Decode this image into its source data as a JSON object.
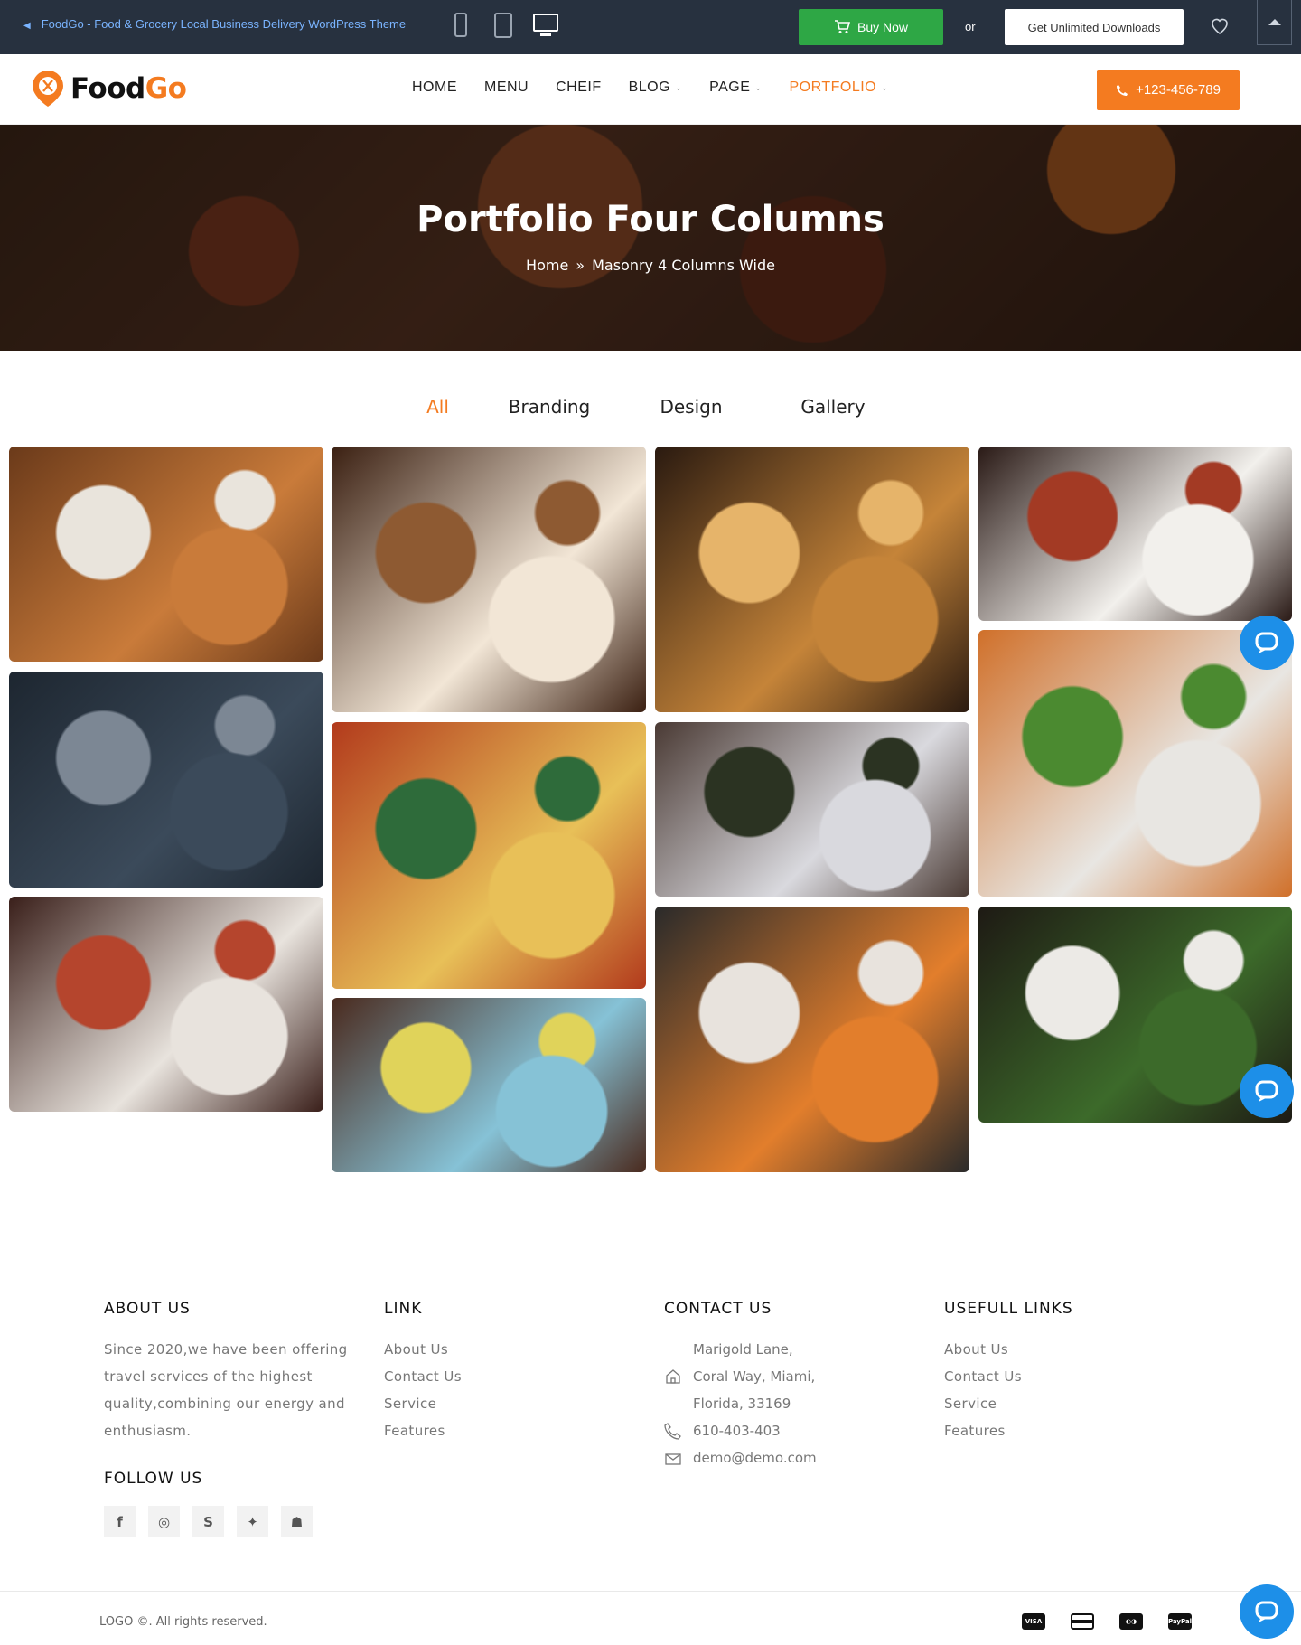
{
  "topbar": {
    "back_text": "FoodGo - Food & Grocery Local Business Delivery WordPress Theme",
    "buy_label": "Buy Now",
    "or_text": "or",
    "download_label": "Get Unlimited Downloads"
  },
  "header": {
    "logo_part1": "Food",
    "logo_part2": "Go",
    "nav": [
      {
        "label": "HOME"
      },
      {
        "label": "MENU"
      },
      {
        "label": "CHEIF"
      },
      {
        "label": "BLOG"
      },
      {
        "label": "PAGE"
      },
      {
        "label": "PORTFOLIO"
      }
    ],
    "phone": "+123-456-789"
  },
  "hero": {
    "title": "Portfolio Four Columns",
    "crumb_home": "Home",
    "crumb_sep": "»",
    "crumb_current": "Masonry 4 Columns Wide"
  },
  "filters": [
    "All",
    "Branding",
    "Design",
    "Gallery"
  ],
  "gallery": [
    {
      "name": "restaurant-plates-photo",
      "colors": [
        "#6b3a1a",
        "#c97b3a",
        "#e9e4dc"
      ]
    },
    {
      "name": "restaurant-interior-photo",
      "colors": [
        "#1d2630",
        "#3b4a5a",
        "#7c8794"
      ]
    },
    {
      "name": "salad-plates-photo",
      "colors": [
        "#3a1f1a",
        "#e8e3dd",
        "#b5452d"
      ]
    },
    {
      "name": "cupcakes-photo",
      "colors": [
        "#3b2012",
        "#f2e6d6",
        "#8e5a32"
      ]
    },
    {
      "name": "mexican-food-photo",
      "colors": [
        "#b23a1c",
        "#e8c058",
        "#2e6b3a"
      ]
    },
    {
      "name": "salad-bowl-photo",
      "colors": [
        "#4a2a1e",
        "#86c2d6",
        "#e0d35a"
      ]
    },
    {
      "name": "curry-pots-photo",
      "colors": [
        "#2a1a10",
        "#c58439",
        "#e6b46a"
      ]
    },
    {
      "name": "olives-buffet-photo",
      "colors": [
        "#4a3a34",
        "#d9d9de",
        "#2b3322"
      ]
    },
    {
      "name": "burgers-table-photo",
      "colors": [
        "#2a2a2a",
        "#e27e2c",
        "#e8e3dd"
      ]
    },
    {
      "name": "waiter-salad-photo",
      "colors": [
        "#2a1a16",
        "#f2f0ec",
        "#a33a24"
      ]
    },
    {
      "name": "grilled-chicken-photo",
      "colors": [
        "#d0702a",
        "#e8e6e2",
        "#4b8a30"
      ]
    },
    {
      "name": "greens-plates-photo",
      "colors": [
        "#1e1a14",
        "#3c6a2a",
        "#eceae6"
      ]
    }
  ],
  "footer": {
    "about_title": "ABOUT US",
    "about_text": "Since 2020,we have been offering travel services of the highest quality,combining our energy and enthusiasm.",
    "follow_title": "FOLLOW US",
    "link_title": "LINK",
    "links": [
      "About Us",
      "Contact Us",
      "Service",
      "Features"
    ],
    "contact_title": "CONTACT US",
    "address1": "Marigold Lane,",
    "address2": "Coral Way, Miami,",
    "address3": "Florida, 33169",
    "phone": "610-403-403",
    "email": "demo@demo.com",
    "useful_title": "USEFULL LINKS",
    "useful_links": [
      "About Us",
      "Contact Us",
      "Service",
      "Features"
    ],
    "copyright": "LOGO ©. All rights reserved.",
    "payments": [
      "visa-icon",
      "credit-card-icon",
      "mastercard-icon",
      "paypal-icon"
    ]
  },
  "colors": {
    "accent": "#f47b20",
    "buy_green": "#2ea745",
    "topbar_bg": "#27313f",
    "chat_blue": "#1d8fe8"
  }
}
